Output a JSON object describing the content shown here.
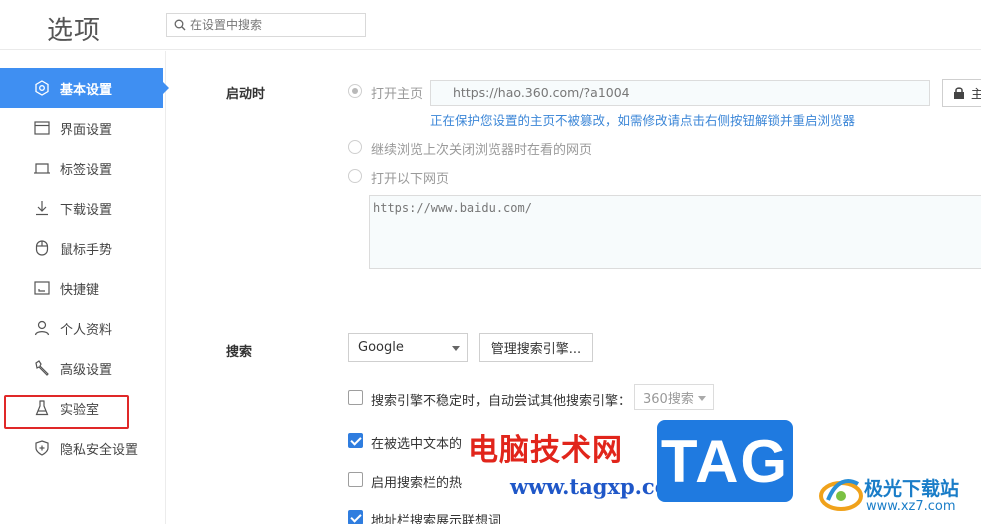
{
  "header": {
    "title": "选项",
    "search_placeholder": "在设置中搜索"
  },
  "sidebar": {
    "items": [
      {
        "label": "基本设置",
        "icon": "gear-icon"
      },
      {
        "label": "界面设置",
        "icon": "window-icon"
      },
      {
        "label": "标签设置",
        "icon": "tab-icon"
      },
      {
        "label": "下载设置",
        "icon": "download-icon"
      },
      {
        "label": "鼠标手势",
        "icon": "mouse-icon"
      },
      {
        "label": "快捷键",
        "icon": "keyboard-icon"
      },
      {
        "label": "个人资料",
        "icon": "user-icon"
      },
      {
        "label": "高级设置",
        "icon": "wrench-icon"
      },
      {
        "label": "实验室",
        "icon": "flask-icon"
      },
      {
        "label": "隐私安全设置",
        "icon": "shield-icon"
      }
    ],
    "active_index": 0,
    "highlighted_index": 8
  },
  "startup": {
    "label": "启动时",
    "option_homepage": "打开主页",
    "homepage_url": "https://hao.360.com/?a1004",
    "lock_button_label": "主",
    "protect_note": "正在保护您设置的主页不被篡改，如需修改请点击右侧按钮解锁并重启浏览器",
    "option_continue": "继续浏览上次关闭浏览器时在看的网页",
    "option_open_pages": "打开以下网页",
    "pages_text": "https://www.baidu.com/"
  },
  "search": {
    "label": "搜索",
    "engine_selected": "Google",
    "manage_button_label": "管理搜索引擎...",
    "checkbox_1": {
      "text": "搜索引擎不稳定时，自动尝试其他搜索引擎：",
      "checked": false
    },
    "fallback_selected": "360搜索",
    "checkbox_2": {
      "text": "在被选中文本的",
      "checked": true
    },
    "checkbox_3": {
      "text": "启用搜索栏的热",
      "checked": false
    },
    "checkbox_4": {
      "text": "地址栏搜索展示联想词",
      "checked": true
    }
  },
  "watermark": {
    "cn_text": "电脑技术网",
    "url": "www.tagxp.com",
    "tag": "TAG",
    "site_cn": "极光下载站",
    "site_url": "www.xz7.com"
  },
  "colors": {
    "accent": "#3f8ff2",
    "highlight_border": "#e02828",
    "note_blue": "#3b86d7"
  }
}
